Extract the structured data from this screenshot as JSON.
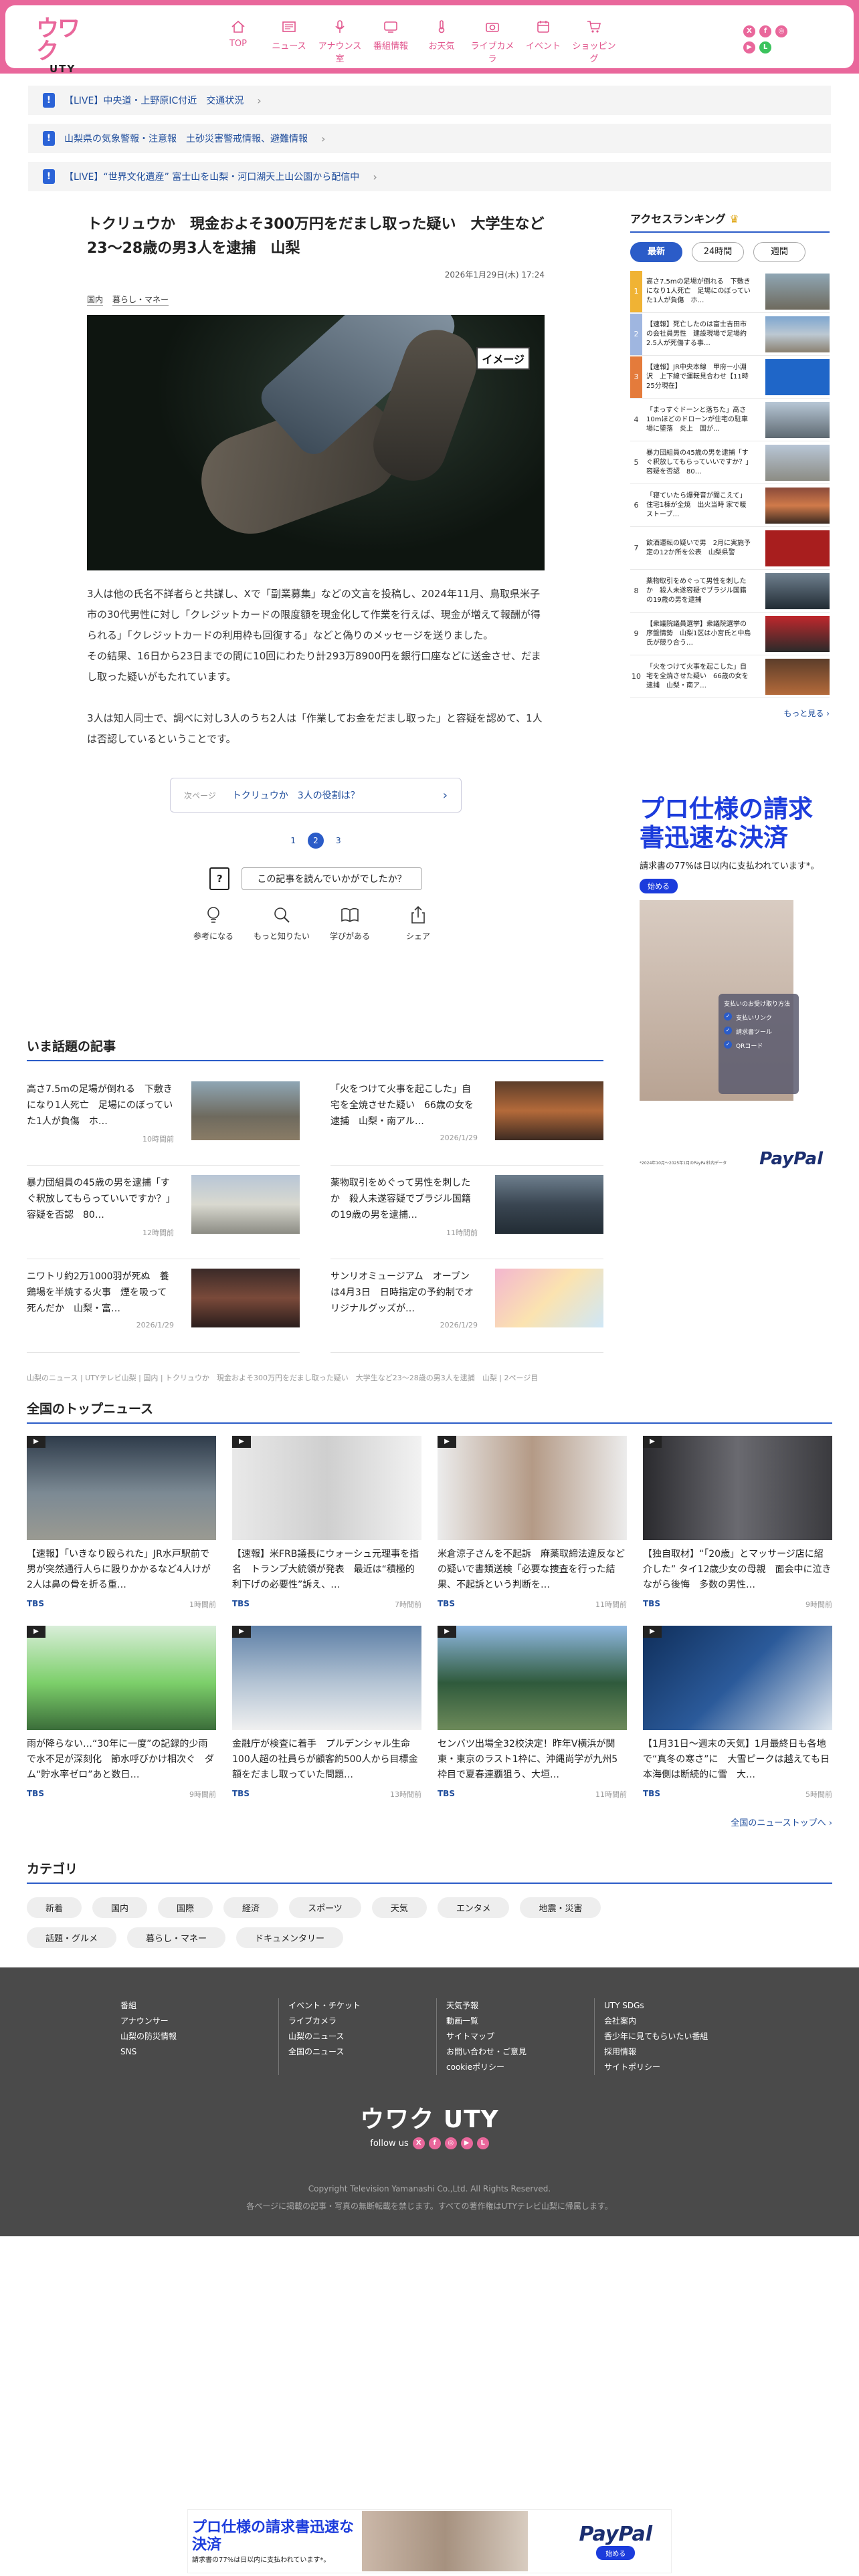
{
  "header": {
    "logo_main": "UTY",
    "nav": [
      {
        "label": "TOP",
        "icon": "home-icon"
      },
      {
        "label": "ニュース",
        "icon": "news-icon"
      },
      {
        "label": "アナウンス室",
        "icon": "mic-icon"
      },
      {
        "label": "番組情報",
        "icon": "tv-icon"
      },
      {
        "label": "お天気",
        "icon": "weather-icon"
      },
      {
        "label": "ライブカメラ",
        "icon": "camera-icon"
      },
      {
        "label": "イベント",
        "icon": "event-icon"
      },
      {
        "label": "ショッピング",
        "icon": "cart-icon"
      }
    ],
    "sns": [
      "X",
      "f",
      "◎",
      "▶",
      "L"
    ]
  },
  "alerts": [
    "【LIVE】中央道・上野原IC付近　交通状況",
    "山梨県の気象警報・注意報　土砂災害警戒情報、避難情報",
    "【LIVE】“世界文化遺産” 富士山を山梨・河口湖天上山公園から配信中"
  ],
  "article": {
    "title": "トクリュウか　現金およそ300万円をだまし取った疑い　大学生など23～28歳の男3人を逮捕　山梨",
    "date": "2026年1月29日(木) 17:24",
    "tags": [
      "国内",
      "暮らし・マネー"
    ],
    "image_badge": "イメージ",
    "body": [
      "3人は他の氏名不詳者らと共謀し、Xで「副業募集」などの文言を投稿し、2024年11月、鳥取県米子市の30代男性に対し「クレジットカードの限度額を現金化して作業を行えば、現金が増えて報酬が得られる」「クレジットカードの利用枠も回復する」などと偽りのメッセージを送りました。",
      "その結果、16日から23日までの間に10回にわたり計293万8900円を銀行口座などに送金させ、だまし取った疑いがもたれています。",
      "",
      "3人は知人同士で、調べに対し3人のうち2人は「作業してお金をだまし取った」と容疑を認めて、1人は否認しているということです。"
    ],
    "next_label": "次ページ",
    "next_title": "トクリュウか　3人の役割は？",
    "pages": [
      "1",
      "2",
      "3"
    ],
    "question": "この記事を読んでいかがでしたか？",
    "reactions": [
      {
        "label": "参考になる",
        "icon": "lightbulb-icon"
      },
      {
        "label": "もっと知りたい",
        "icon": "magnifier-icon"
      },
      {
        "label": "学びがある",
        "icon": "book-icon"
      },
      {
        "label": "シェア",
        "icon": "share-icon"
      }
    ]
  },
  "hot": {
    "title": "いま話題の記事",
    "items": [
      {
        "text": "高さ7.5mの足場が倒れる　下敷きになり1人死亡　足場にのぼっていた1人が負傷　ホ…",
        "time": "10時間前"
      },
      {
        "text": "「火をつけて火事を起こした」自宅を全焼させた疑い　66歳の女を逮捕　山梨・南アル…",
        "time": "2026/1/29"
      },
      {
        "text": "暴力団組員の45歳の男を逮捕「すぐ釈放してもらっていいですか？」容疑を否認　80…",
        "time": "12時間前"
      },
      {
        "text": "薬物取引をめぐって男性を刺したか　殺人未遂容疑でブラジル国籍の19歳の男を逮捕…",
        "time": "11時間前"
      },
      {
        "text": "ニワトリ約2万1000羽が死ぬ　養鶏場を半焼する火事　煙を吸って死んだか　山梨・富…",
        "time": "2026/1/29"
      },
      {
        "text": "サンリオミュージアム　オープンは4月3日　日時指定の予約制でオリジナルグッズが…",
        "time": "2026/1/29"
      }
    ]
  },
  "breadcrumb": "山梨のニュース | UTYテレビ山梨 | 国内 | トクリュウか　現金およそ300万円をだまし取った疑い　大学生など23～28歳の男3人を逮捕　山梨 | 2ページ目",
  "top_news": {
    "title": "全国のトップニュース",
    "items": [
      {
        "text": "【速報】「いきなり殴られた」JR水戸駅前で男が突然通行人らに殴りかかるなど4人けが　2人は鼻の骨を折る重…",
        "src": "TBS",
        "time": "1時間前"
      },
      {
        "text": "【速報】米FRB議長にウォーシュ元理事を指名　トランプ大統領が発表　最近は“積極的利下げの必要性”訴え、…",
        "src": "TBS",
        "time": "7時間前"
      },
      {
        "text": "米倉涼子さんを不起訴　麻薬取締法違反などの疑いで書類送検「必要な捜査を行った結果、不起訴という判断を…",
        "src": "TBS",
        "time": "11時間前"
      },
      {
        "text": "【独自取材】“「20歳」とマッサージ店に紹介した” タイ12歳少女の母親　面会中に泣きながら後悔　多数の男性…",
        "src": "TBS",
        "time": "9時間前"
      },
      {
        "text": "雨が降らない…“30年に一度”の記録的少雨で水不足が深刻化　節水呼びかけ相次ぐ　ダム“貯水率ゼロ”あと数日…",
        "src": "TBS",
        "time": "9時間前"
      },
      {
        "text": "金融庁が検査に着手　プルデンシャル生命100人超の社員らが顧客約500人から目標金額をだまし取っていた問題…",
        "src": "TBS",
        "time": "13時間前"
      },
      {
        "text": "センバツ出場全32校決定！昨年V横浜が関東・東京のラスト1枠に、沖縄尚学が九州5枠目で夏春連覇狙う、大垣…",
        "src": "TBS",
        "time": "11時間前"
      },
      {
        "text": "【1月31日～週末の天気】1月最終日も各地で“真冬の寒さ”に　大雪ピークは越えても日本海側は断続的に雪　大…",
        "src": "TBS",
        "time": "5時間前"
      }
    ],
    "more": "全国のニューストップへ ›"
  },
  "categories": {
    "title": "カテゴリ",
    "items": [
      "新着",
      "国内",
      "国際",
      "経済",
      "スポーツ",
      "天気",
      "エンタメ",
      "地震・災害",
      "話題・グルメ",
      "暮らし・マネー",
      "ドキュメンタリー"
    ]
  },
  "ranking": {
    "title": "アクセスランキング",
    "tabs": [
      "最新",
      "24時間",
      "週間"
    ],
    "items": [
      {
        "n": "1",
        "text": "高さ7.5mの足場が倒れる　下敷きになり1人死亡　足場にのぼっていた1人が負傷　ホ…"
      },
      {
        "n": "2",
        "text": "【速報】死亡したのは富士吉田市の会社員男性　建設現場で足場約2.5人が死傷する事…"
      },
      {
        "n": "3",
        "text": "【速報】JR中央本線　甲府ー小淵沢　上下線で運転見合わせ【11時25分現在】"
      },
      {
        "n": "4",
        "text": "「まっすぐドーンと落ちた」高さ10mほどのドローンが住宅の駐車場に墜落　炎上　国が…"
      },
      {
        "n": "5",
        "text": "暴力団組員の45歳の男を逮捕「すぐ釈放してもらっていいですか？」容疑を否認　80…"
      },
      {
        "n": "6",
        "text": "「寝ていたら爆発音が聞こえて」住宅1棟が全焼　出火当時 家で暖ストーブ…"
      },
      {
        "n": "7",
        "text": "飲酒運転の疑いで男　2月に実施予定の12か所を公表　山梨県警"
      },
      {
        "n": "8",
        "text": "薬物取引をめぐって男性を刺したか　殺人未遂容疑でブラジル国籍の19歳の男を逮捕"
      },
      {
        "n": "9",
        "text": "【衆議院議員選挙】衆議院選挙の序盤情勢　山梨1区は小宮氏と中島氏が競り合う…"
      },
      {
        "n": "10",
        "text": "「火をつけて火事を起こした」自宅を全焼させた疑い　66歳の女を逮捕　山梨・南ア…"
      }
    ],
    "more": "もっと見る ›"
  },
  "ad_side": {
    "headline": "プロ仕様の請求書迅速な決済",
    "sub": "請求書の77%は日以内に支払われています*。",
    "button": "始める",
    "card_title": "支払いのお受け取り方法",
    "card_items": [
      "支払いリンク",
      "請求書ツール",
      "QRコード"
    ],
    "brand": "PayPal",
    "fine": "*2024年10月〜2025年1月のPayPal社内データ"
  },
  "footer": {
    "cols": [
      [
        "番組",
        "アナウンサー",
        "山梨の防災情報",
        "SNS"
      ],
      [
        "イベント・チケット",
        "ライブカメラ",
        "山梨のニュース",
        "全国のニュース"
      ],
      [
        "天気予報",
        "動画一覧",
        "サイトマップ",
        "お問い合わせ・ご意見",
        "cookieポリシー"
      ],
      [
        "UTY SDGs",
        "会社案内",
        "香少年に見てもらいたい番組",
        "採用情報",
        "サイトポリシー"
      ]
    ],
    "logo": "UTY",
    "follow": "follow us",
    "copyright": "Copyright Television Yamanashi Co.,Ltd. All Rights Reserved.",
    "notice": "各ページに掲載の記事・写真の無断転載を禁じます。すべての著作権はUTYテレビ山梨に帰属します。"
  },
  "ad_bottom": {
    "headline": "プロ仕様の請求書迅速な決済",
    "sub": "請求書の77%は日以内に支払われています*。",
    "brand": "PayPal",
    "button": "始める"
  }
}
